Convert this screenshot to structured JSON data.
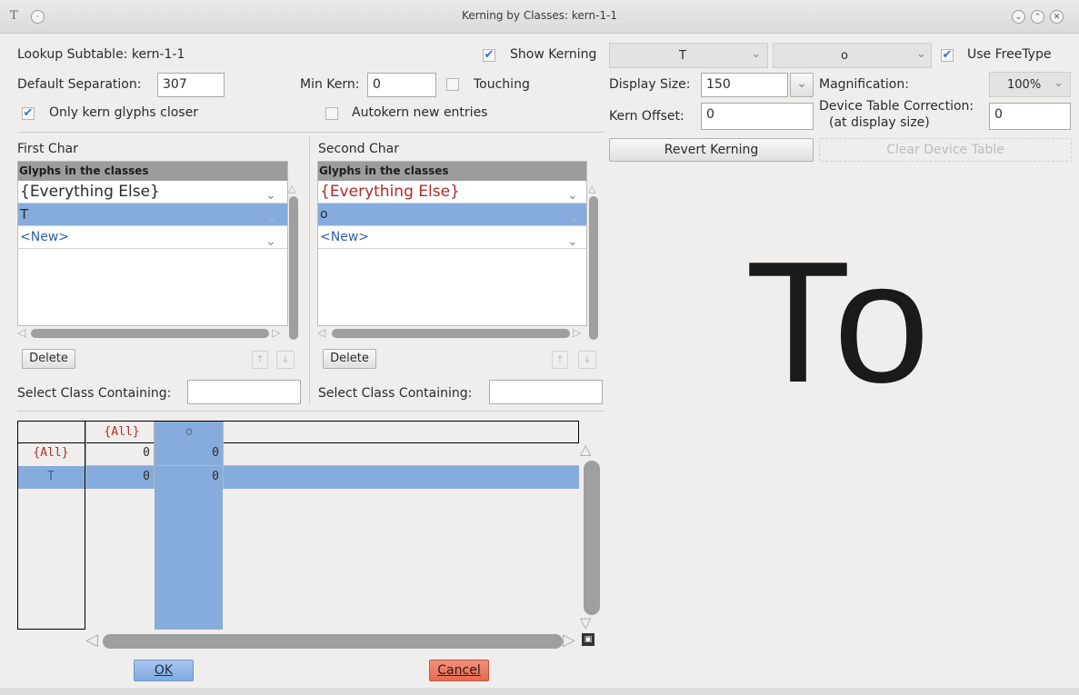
{
  "window": {
    "title": "Kerning by Classes: kern-1-1",
    "app_icon": "T"
  },
  "top": {
    "lookup_subtable": "Lookup Subtable: kern-1-1",
    "show_kerning": "Show Kerning",
    "first_glyph": "T",
    "second_glyph": "o",
    "use_freetype": "Use FreeType",
    "default_sep_label": "Default Separation:",
    "default_sep_value": "307",
    "min_kern_label": "Min Kern:",
    "min_kern_value": "0",
    "touching": "Touching",
    "only_kern_closer": "Only kern glyphs closer",
    "autokern_new": "Autokern new entries",
    "display_size_label": "Display Size:",
    "display_size_value": "150",
    "magnification_label": "Magnification:",
    "magnification_value": "100%",
    "kern_offset_label": "Kern Offset:",
    "kern_offset_value": "0",
    "device_table_label": "Device Table Correction:",
    "device_table_sub": "(at display size)",
    "device_table_value": "0",
    "revert_kerning": "Revert Kerning",
    "clear_device_table": "Clear Device Table"
  },
  "first_char": {
    "label": "First Char",
    "list_header": "Glyphs in the classes",
    "items": [
      "{Everything Else}",
      "T",
      "<New>"
    ],
    "delete": "Delete",
    "select_class_label": "Select Class Containing:",
    "select_class_value": ""
  },
  "second_char": {
    "label": "Second Char",
    "list_header": "Glyphs in the classes",
    "items": [
      "{Everything Else}",
      "o",
      "<New>"
    ],
    "delete": "Delete",
    "select_class_label": "Select Class Containing:",
    "select_class_value": ""
  },
  "matrix": {
    "col_headers": [
      "{All}",
      "o"
    ],
    "rows": [
      {
        "label": "{All}",
        "values": [
          "0",
          "0"
        ]
      },
      {
        "label": "T",
        "values": [
          "0",
          "0"
        ]
      }
    ]
  },
  "preview": {
    "text": "To"
  },
  "buttons": {
    "ok": "OK",
    "cancel": "Cancel"
  },
  "colors": {
    "selection": "#86acdd",
    "class_red": "#b02a2a",
    "new_blue": "#2f5fa5",
    "cancel": "#e8785f"
  }
}
